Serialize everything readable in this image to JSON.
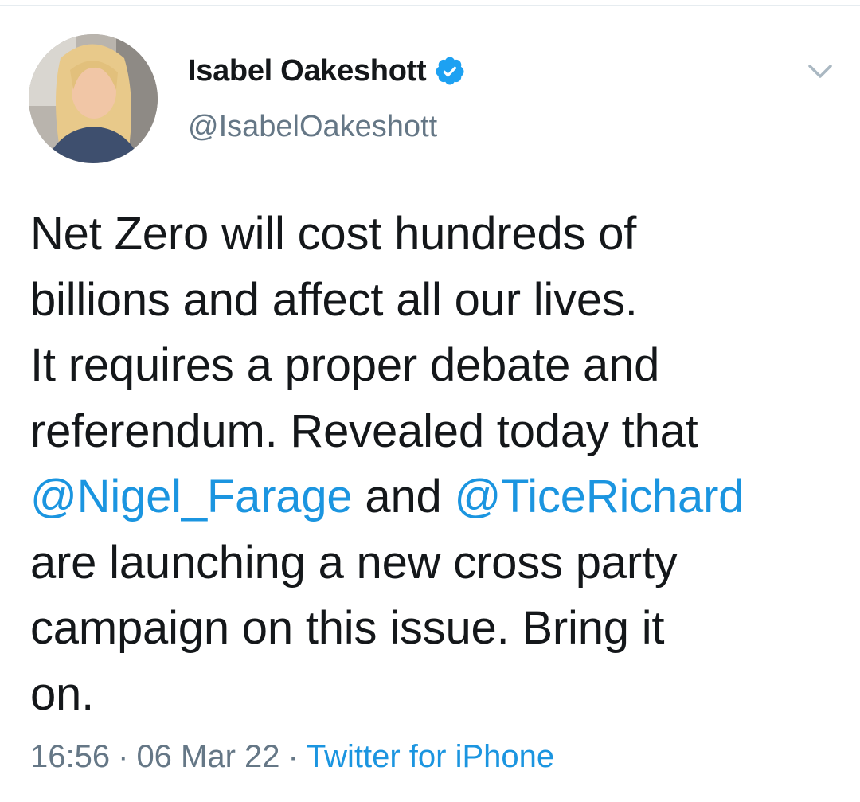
{
  "tweet": {
    "author": {
      "display_name": "Isabel Oakeshott",
      "handle": "@IsabelOakeshott",
      "verified": true,
      "avatar_icon": "profile-photo"
    },
    "text_lines": [
      "Net Zero will cost hundreds of",
      "billions and affect all our lives.",
      "It requires a proper debate and",
      "referendum. Revealed today that"
    ],
    "mention_line": {
      "mention_1": "@Nigel_Farage",
      "connector": " and ",
      "mention_2": "@TiceRichard"
    },
    "text_lines_end": [
      "are launching a new cross party",
      "campaign on this issue. Bring it",
      "on."
    ],
    "time": "16:56",
    "date": "06 Mar 22",
    "separator": "·",
    "source": "Twitter for iPhone"
  },
  "colors": {
    "link": "#1b95e0",
    "secondary_text": "#657786",
    "primary_text": "#14171a",
    "verified_badge": "#1da1f2"
  },
  "icons": {
    "verified": "verified-badge-icon",
    "menu": "chevron-down-icon"
  }
}
